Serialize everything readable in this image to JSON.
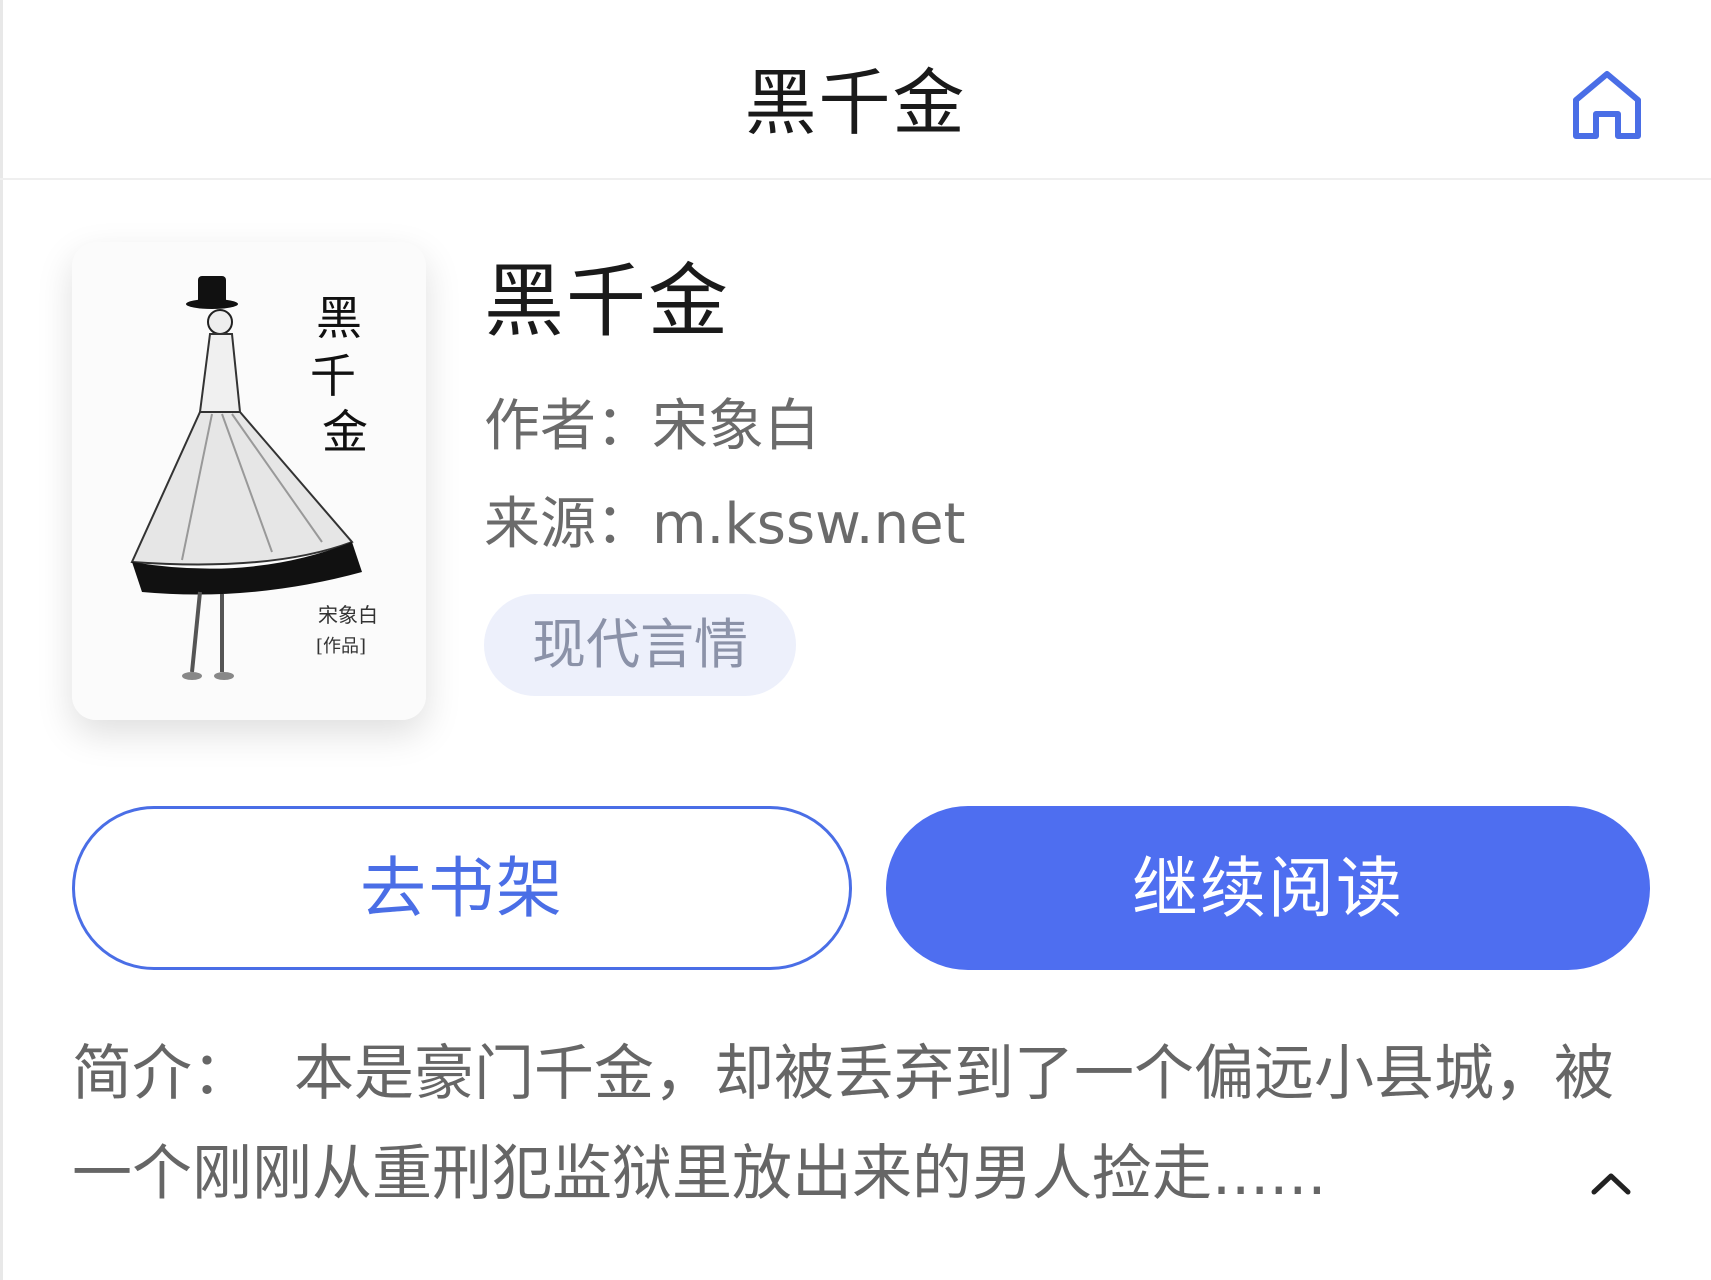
{
  "header": {
    "title": "黑千金",
    "home_icon": "home-icon"
  },
  "book": {
    "cover_title": "黑千金",
    "cover_author": "宋象白",
    "cover_suffix": "[作品]",
    "title": "黑千金",
    "author_line": "作者：宋象白",
    "source_line": "来源：m.kssw.net",
    "tag": "现代言情"
  },
  "actions": {
    "shelf_label": "去书架",
    "read_label": "继续阅读"
  },
  "intro": {
    "label": "简介：",
    "text": "本是豪门千金，却被丢弃到了一个偏远小县城，被一个刚刚从重刑犯监狱里放出来的男人捡走......",
    "collapse_icon": "chevron-up-icon"
  },
  "colors": {
    "accent": "#4e6ef0",
    "tag_bg": "#edf0fb",
    "text_secondary": "#6b6b6b"
  }
}
